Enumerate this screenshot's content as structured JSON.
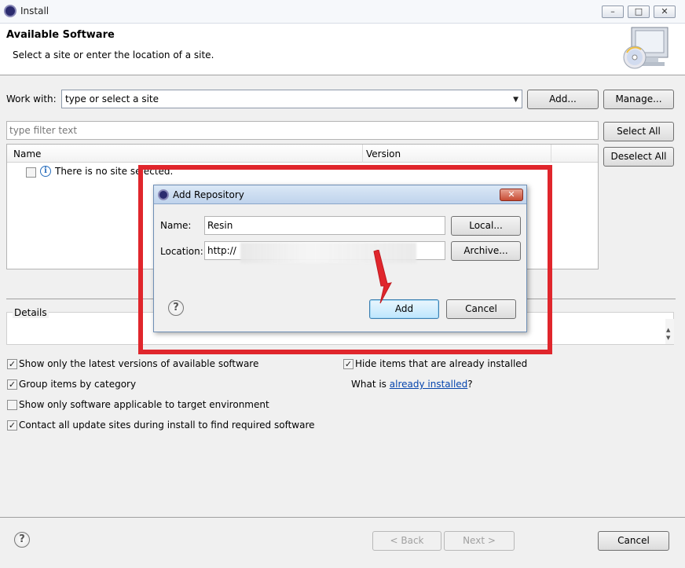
{
  "window": {
    "title": "Install",
    "minimize": "–",
    "maximize": "□",
    "close": "✕"
  },
  "header": {
    "title": "Available Software",
    "description": "Select a site or enter the location of a site."
  },
  "work_with": {
    "label": "Work with:",
    "value": "type or select a site",
    "add_button": "Add...",
    "manage_button": "Manage..."
  },
  "filter": {
    "placeholder": "type filter text"
  },
  "selection": {
    "select_all": "Select All",
    "deselect_all": "Deselect All"
  },
  "tree": {
    "columns": [
      "Name",
      "Version"
    ],
    "message": "There is no site selected."
  },
  "details": {
    "label": "Details"
  },
  "options": {
    "latest_versions": "Show only the latest versions of available software",
    "group_by_category": "Group items by category",
    "target_environment": "Show only software applicable to target environment",
    "contact_update_sites": "Contact all update sites during install to find required software",
    "hide_installed": "Hide items that are already installed",
    "what_is_prefix": "What is ",
    "what_is_link": "already installed",
    "what_is_suffix": "?",
    "checked": {
      "latest_versions": true,
      "group_by_category": true,
      "target_environment": false,
      "contact_update_sites": true,
      "hide_installed": true
    }
  },
  "footer": {
    "back": "< Back",
    "next": "Next >",
    "cancel": "Cancel"
  },
  "dialog": {
    "title": "Add Repository",
    "close": "✕",
    "name_label": "Name:",
    "name_value": "Resin",
    "location_label": "Location:",
    "location_value": "http://",
    "local_button": "Local...",
    "archive_button": "Archive...",
    "add_button": "Add",
    "cancel_button": "Cancel"
  },
  "colors": {
    "highlight": "#e0262c",
    "link": "#0645ad"
  }
}
